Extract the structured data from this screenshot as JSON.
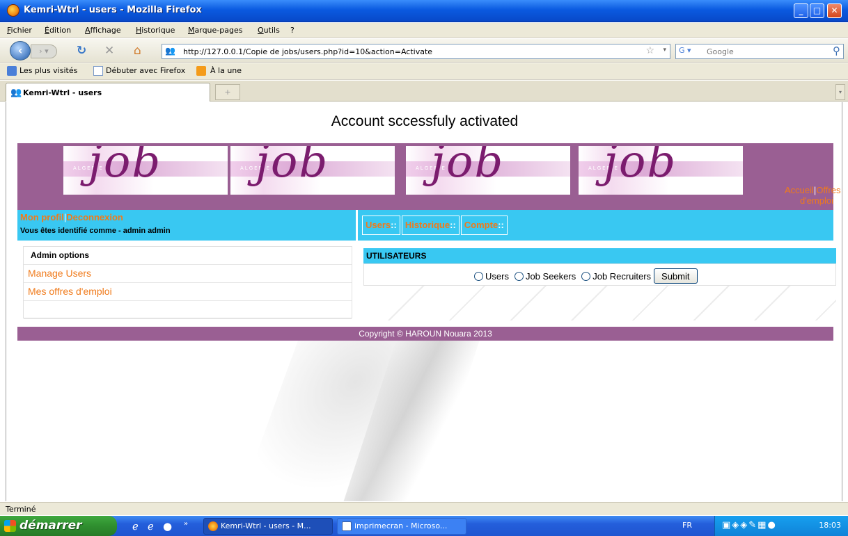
{
  "window": {
    "title": "Kemri-Wtrl - users - Mozilla Firefox",
    "minimize": "_",
    "maximize": "□",
    "close": "✕"
  },
  "menubar": {
    "items": [
      "Fichier",
      "Édition",
      "Affichage",
      "Historique",
      "Marque-pages",
      "Outils",
      "?"
    ]
  },
  "navbar": {
    "url": "http://127.0.0.1/Copie de jobs/users.php?id=10&action=Activate",
    "search_placeholder": "Google"
  },
  "bookmarks": {
    "items": [
      "Les plus visités",
      "Débuter avec Firefox",
      "À la une"
    ]
  },
  "tabs": {
    "active_label": "Kemri-Wtrl - users",
    "new_tab": "+"
  },
  "page": {
    "heading": "Account sccessfuly activated",
    "logo": {
      "word": "job",
      "tagline": "ALGERIE"
    },
    "banner_links": {
      "accueil": "Accueil",
      "separator": "|",
      "offres": "Offres d'emploi"
    },
    "user_links": {
      "profil": "Mon profil",
      "separator": "|",
      "deconnexion": "Deconnexion"
    },
    "identified_as": "Vous êtes identifié comme - admin admin",
    "top_menu": [
      {
        "label": "Users",
        "suffix": "::"
      },
      {
        "label": "Historique",
        "suffix": "::"
      },
      {
        "label": "Compte",
        "suffix": "::"
      }
    ],
    "admin_panel": {
      "title": "Admin options",
      "links": [
        "Manage Users",
        "Mes offres d'emploi"
      ]
    },
    "users_panel": {
      "title": "UTILISATEURS",
      "options": [
        "Users",
        "Job Seekers",
        "Job Recruiters"
      ],
      "submit": "Submit"
    },
    "footer": "Copyright © HAROUN Nouara 2013"
  },
  "statusbar": {
    "text": "Terminé"
  },
  "taskbar": {
    "start": "démarrer",
    "tasks": [
      "Kemri-Wtrl - users - M...",
      "imprimecran - Microso..."
    ],
    "lang": "FR",
    "clock": "18:03"
  }
}
